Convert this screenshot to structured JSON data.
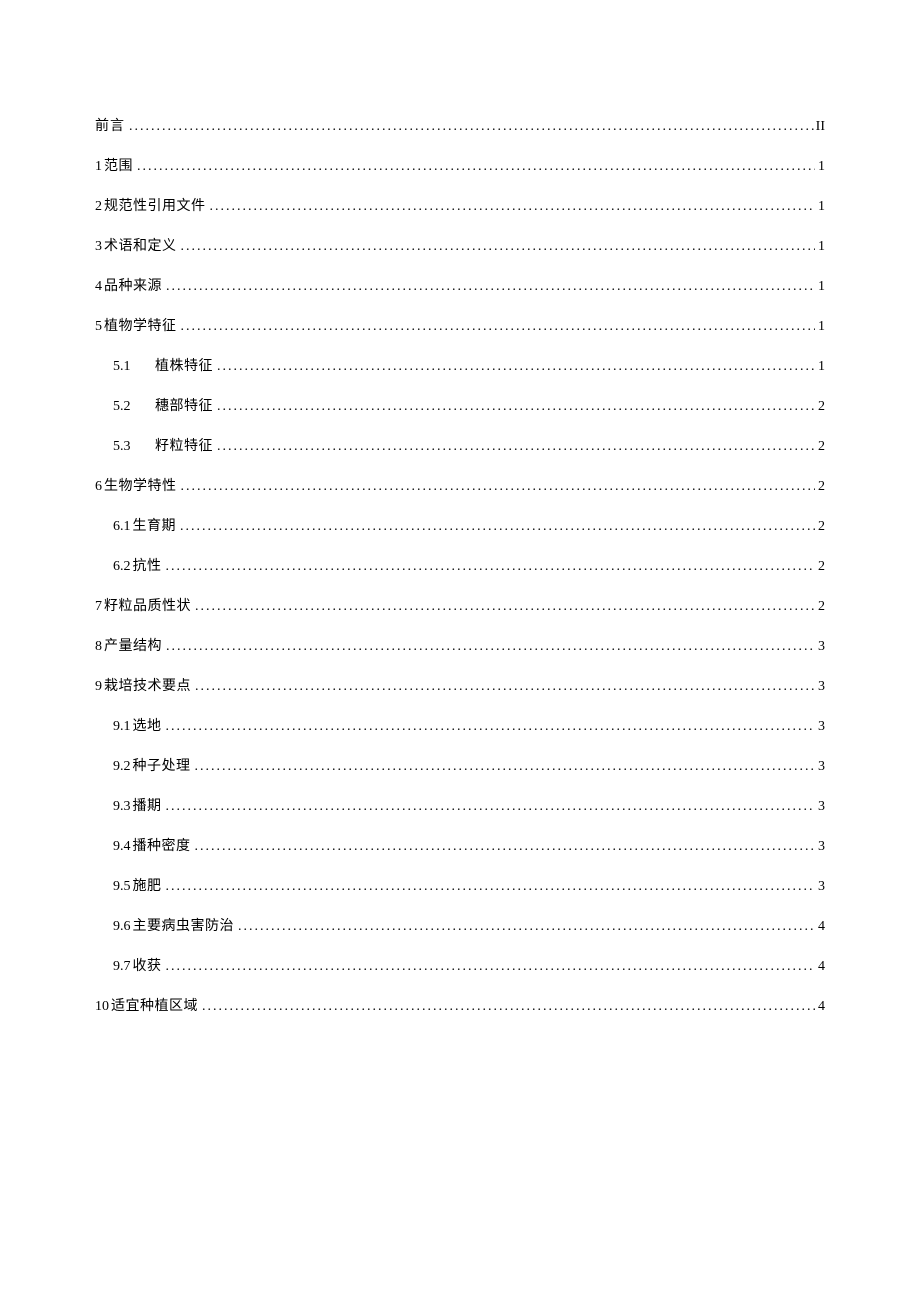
{
  "toc": [
    {
      "level": 0,
      "num": "",
      "title": "前言",
      "page": "II",
      "widegap": false
    },
    {
      "level": 0,
      "num": "1",
      "title": "范围",
      "page": "1",
      "widegap": false
    },
    {
      "level": 0,
      "num": "2",
      "title": "规范性引用文件",
      "page": "1",
      "widegap": false
    },
    {
      "level": 0,
      "num": "3",
      "title": "术语和定义",
      "page": "1",
      "widegap": false
    },
    {
      "level": 0,
      "num": "4",
      "title": "品种来源",
      "page": "1",
      "widegap": false
    },
    {
      "level": 0,
      "num": "5",
      "title": "植物学特征",
      "page": "1",
      "widegap": false
    },
    {
      "level": 1,
      "num": "5.1",
      "title": "植株特征",
      "page": "1",
      "widegap": true
    },
    {
      "level": 1,
      "num": "5.2",
      "title": "穗部特征",
      "page": "2",
      "widegap": true
    },
    {
      "level": 1,
      "num": "5.3",
      "title": "籽粒特征",
      "page": "2",
      "widegap": true
    },
    {
      "level": 0,
      "num": "6",
      "title": "生物学特性",
      "page": "2",
      "widegap": false
    },
    {
      "level": 1,
      "num": "6.1",
      "title": "生育期",
      "page": "2",
      "widegap": false
    },
    {
      "level": 1,
      "num": "6.2",
      "title": "抗性",
      "page": "2",
      "widegap": false
    },
    {
      "level": 0,
      "num": "7",
      "title": "籽粒品质性状",
      "page": "2",
      "widegap": false
    },
    {
      "level": 0,
      "num": "8",
      "title": "产量结构",
      "page": "3",
      "widegap": false
    },
    {
      "level": 0,
      "num": "9",
      "title": "栽培技术要点",
      "page": "3",
      "widegap": false
    },
    {
      "level": 1,
      "num": "9.1",
      "title": "选地",
      "page": "3",
      "widegap": false
    },
    {
      "level": 1,
      "num": "9.2",
      "title": "种子处理",
      "page": "3",
      "widegap": false
    },
    {
      "level": 1,
      "num": "9.3",
      "title": "播期",
      "page": "3",
      "widegap": false
    },
    {
      "level": 1,
      "num": "9.4",
      "title": "播种密度",
      "page": "3",
      "widegap": false
    },
    {
      "level": 1,
      "num": "9.5",
      "title": "施肥",
      "page": "3",
      "widegap": false
    },
    {
      "level": 1,
      "num": "9.6",
      "title": "主要病虫害防治",
      "page": "4",
      "widegap": false
    },
    {
      "level": 1,
      "num": "9.7",
      "title": "收获",
      "page": "4",
      "widegap": false
    },
    {
      "level": 0,
      "num": "10",
      "title": "适宜种植区域",
      "page": "4",
      "widegap": false
    }
  ]
}
